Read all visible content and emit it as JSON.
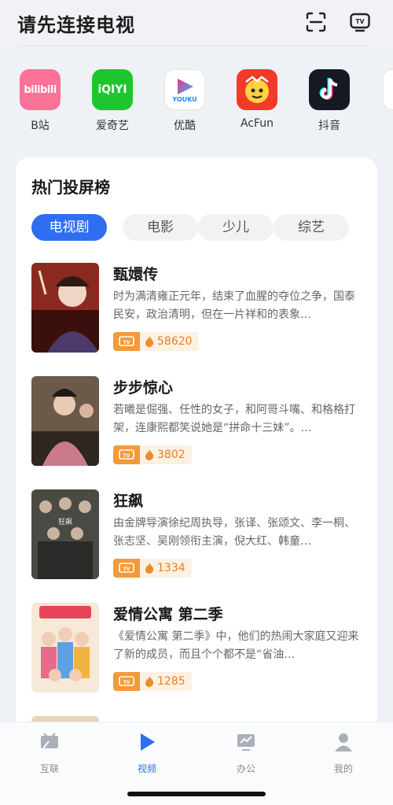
{
  "header": {
    "title": "请先连接电视",
    "scan_icon": "scan-icon",
    "tv_icon": "tv-icon"
  },
  "apps": [
    {
      "label": "B站",
      "logo_text": "bilibili",
      "color": "#fb7299"
    },
    {
      "label": "爱奇艺",
      "logo_text": "iQIYI",
      "color": "#1fc52e"
    },
    {
      "label": "优酷",
      "logo_text": "YOUKU",
      "color": "#ffffff"
    },
    {
      "label": "AcFun",
      "logo_text": "",
      "color": "#f03a2a"
    },
    {
      "label": "抖音",
      "logo_text": "",
      "color": "#161823"
    }
  ],
  "hot": {
    "title": "热门投屏榜",
    "tabs": [
      "电视剧",
      "电影",
      "少儿",
      "综艺"
    ],
    "active_tab": "电视剧",
    "items": [
      {
        "title": "甄嬛传",
        "desc": "时为满清雍正元年，结束了血腥的夺位之争，国泰民安，政治清明，但在一片祥和的表象…",
        "count": "58620",
        "tv_badge": "TV"
      },
      {
        "title": "步步惊心",
        "desc": "若曦是倔强、任性的女子，和阿哥斗嘴、和格格打架，连康熙都笑说她是“拼命十三妹”。…",
        "count": "3802",
        "tv_badge": "TV"
      },
      {
        "title": "狂飙",
        "desc": "由金牌导演徐纪周执导，张译、张颂文、李一桐、张志坚、吴刚领衔主演，倪大红、韩童…",
        "count": "1334",
        "tv_badge": "TV"
      },
      {
        "title": "爱情公寓 第二季",
        "desc": "《爱情公寓 第二季》中，他们的热闹大家庭又迎来了新的成员，而且个个都不是“省油…",
        "count": "1285",
        "tv_badge": "TV"
      }
    ]
  },
  "bottom_nav": [
    {
      "label": "互联",
      "icon": "cast-icon"
    },
    {
      "label": "视频",
      "icon": "play-icon"
    },
    {
      "label": "办公",
      "icon": "presentation-icon"
    },
    {
      "label": "我的",
      "icon": "user-icon"
    }
  ],
  "colors": {
    "accent": "#2f6ef0",
    "heat": "#e8801e",
    "tv_badge": "#f49a3b"
  }
}
